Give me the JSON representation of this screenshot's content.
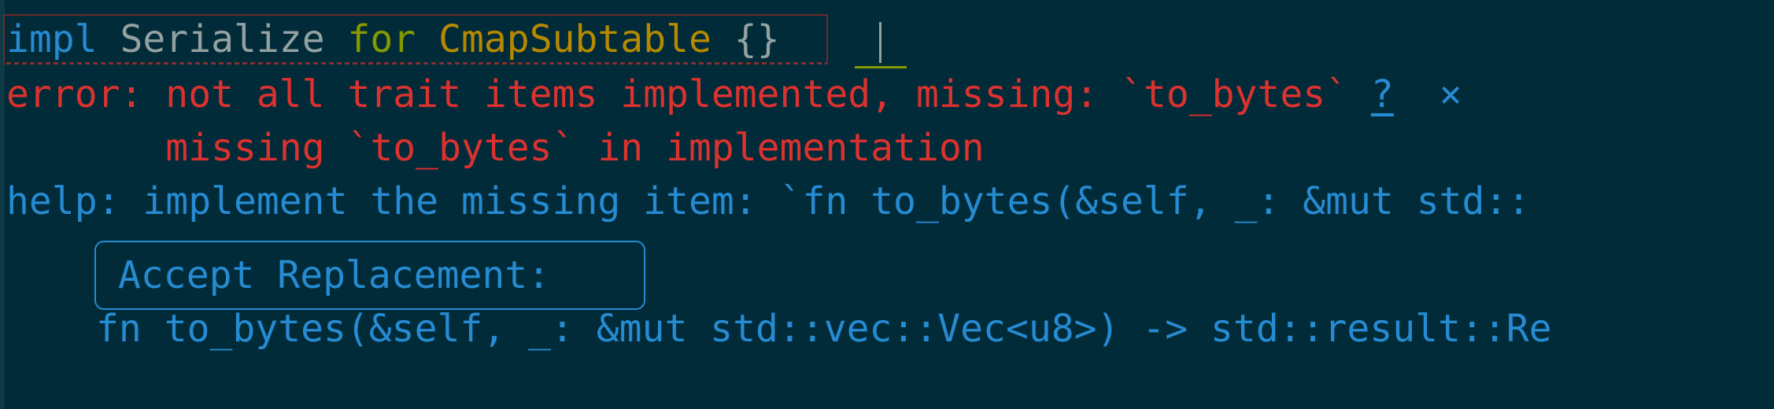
{
  "code_line": {
    "kw_impl": "impl",
    "trait_name": "Serialize",
    "kw_for": "for",
    "type_name": "CmapSubtable",
    "brace_open": "{",
    "brace_close": "}"
  },
  "diagnostic": {
    "error_text": "error: not all trait items implemented, missing: `to_bytes`",
    "help_link": "?",
    "close_glyph": "×",
    "detail": "missing `to_bytes` in implementation",
    "help_text": "help: implement the missing item: `fn to_bytes(&self, _: &mut std::"
  },
  "action": {
    "accept_label": "Accept Replacement:",
    "replacement_code": "fn to_bytes(&self, _: &mut std::vec::Vec<u8>) -> std::result::Re"
  },
  "colors": {
    "background": "#012b38",
    "error": "#dc322f",
    "accent": "#268bd2",
    "keyword_for": "#859900",
    "type": "#b58900",
    "plain": "#93a1a1"
  }
}
